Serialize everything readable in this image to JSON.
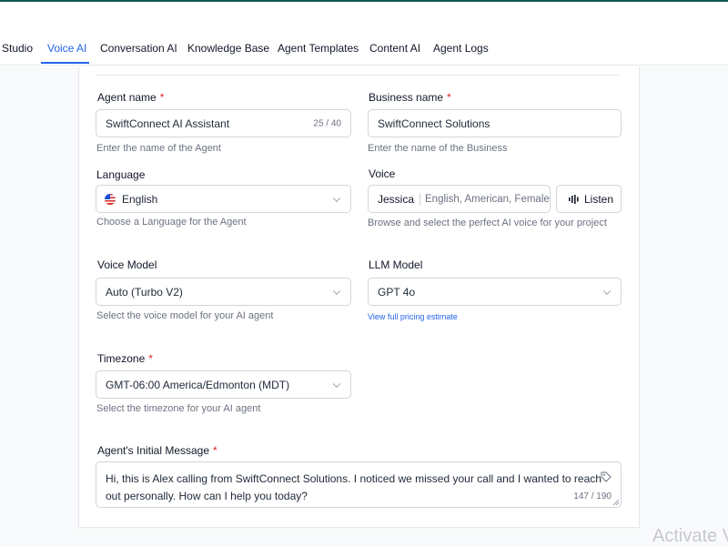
{
  "tabs": [
    {
      "label": "Studio"
    },
    {
      "label": "Voice AI"
    },
    {
      "label": "Conversation AI"
    },
    {
      "label": "Knowledge Base"
    },
    {
      "label": "Agent Templates"
    },
    {
      "label": "Content AI"
    },
    {
      "label": "Agent Logs"
    }
  ],
  "active_tab": "Voice AI",
  "form": {
    "required_mark": "*",
    "agent_name": {
      "label": "Agent name",
      "value": "SwiftConnect AI Assistant",
      "counter": "25 / 40",
      "help": "Enter the name of the Agent"
    },
    "business_name": {
      "label": "Business name",
      "value": "SwiftConnect Solutions",
      "help": "Enter the name of the Business"
    },
    "language": {
      "label": "Language",
      "value": "English",
      "help": "Choose a Language for the Agent",
      "flag_icon": "us-flag-icon"
    },
    "voice": {
      "label": "Voice",
      "name": "Jessica",
      "meta": "English, American, Female",
      "listen_label": "Listen",
      "help": "Browse and select the perfect AI voice for your project"
    },
    "voice_model": {
      "label": "Voice Model",
      "value": "Auto (Turbo V2)",
      "help": "Select the voice model for your AI agent"
    },
    "llm_model": {
      "label": "LLM Model",
      "value": "GPT 4o",
      "link": "View full pricing estimate"
    },
    "timezone": {
      "label": "Timezone",
      "value": "GMT-06:00 America/Edmonton (MDT)",
      "help": "Select the timezone for your AI agent"
    },
    "initial_message": {
      "label": "Agent's Initial Message",
      "value": "Hi, this is Alex calling from SwiftConnect Solutions. I noticed we missed your call and I wanted to reach out personally. How can I help you today?",
      "counter": "147 / 190"
    }
  },
  "watermark": "Activate V",
  "colors": {
    "accent": "#2563eb",
    "required": "#dc2626",
    "top_bar": "#0f5c53"
  }
}
